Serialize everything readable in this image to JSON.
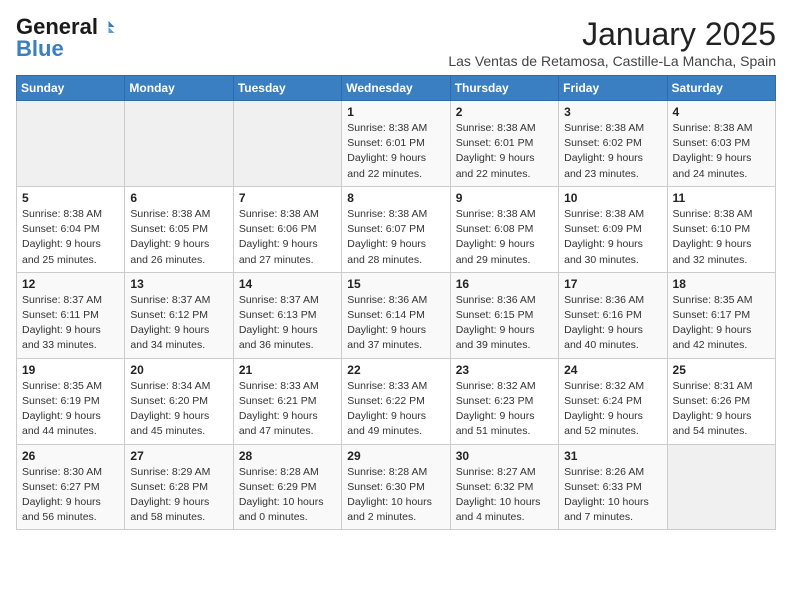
{
  "logo": {
    "general": "General",
    "blue": "Blue"
  },
  "title": "January 2025",
  "location": "Las Ventas de Retamosa, Castille-La Mancha, Spain",
  "weekdays": [
    "Sunday",
    "Monday",
    "Tuesday",
    "Wednesday",
    "Thursday",
    "Friday",
    "Saturday"
  ],
  "weeks": [
    [
      {
        "day": "",
        "info": ""
      },
      {
        "day": "",
        "info": ""
      },
      {
        "day": "",
        "info": ""
      },
      {
        "day": "1",
        "info": "Sunrise: 8:38 AM\nSunset: 6:01 PM\nDaylight: 9 hours\nand 22 minutes."
      },
      {
        "day": "2",
        "info": "Sunrise: 8:38 AM\nSunset: 6:01 PM\nDaylight: 9 hours\nand 22 minutes."
      },
      {
        "day": "3",
        "info": "Sunrise: 8:38 AM\nSunset: 6:02 PM\nDaylight: 9 hours\nand 23 minutes."
      },
      {
        "day": "4",
        "info": "Sunrise: 8:38 AM\nSunset: 6:03 PM\nDaylight: 9 hours\nand 24 minutes."
      }
    ],
    [
      {
        "day": "5",
        "info": "Sunrise: 8:38 AM\nSunset: 6:04 PM\nDaylight: 9 hours\nand 25 minutes."
      },
      {
        "day": "6",
        "info": "Sunrise: 8:38 AM\nSunset: 6:05 PM\nDaylight: 9 hours\nand 26 minutes."
      },
      {
        "day": "7",
        "info": "Sunrise: 8:38 AM\nSunset: 6:06 PM\nDaylight: 9 hours\nand 27 minutes."
      },
      {
        "day": "8",
        "info": "Sunrise: 8:38 AM\nSunset: 6:07 PM\nDaylight: 9 hours\nand 28 minutes."
      },
      {
        "day": "9",
        "info": "Sunrise: 8:38 AM\nSunset: 6:08 PM\nDaylight: 9 hours\nand 29 minutes."
      },
      {
        "day": "10",
        "info": "Sunrise: 8:38 AM\nSunset: 6:09 PM\nDaylight: 9 hours\nand 30 minutes."
      },
      {
        "day": "11",
        "info": "Sunrise: 8:38 AM\nSunset: 6:10 PM\nDaylight: 9 hours\nand 32 minutes."
      }
    ],
    [
      {
        "day": "12",
        "info": "Sunrise: 8:37 AM\nSunset: 6:11 PM\nDaylight: 9 hours\nand 33 minutes."
      },
      {
        "day": "13",
        "info": "Sunrise: 8:37 AM\nSunset: 6:12 PM\nDaylight: 9 hours\nand 34 minutes."
      },
      {
        "day": "14",
        "info": "Sunrise: 8:37 AM\nSunset: 6:13 PM\nDaylight: 9 hours\nand 36 minutes."
      },
      {
        "day": "15",
        "info": "Sunrise: 8:36 AM\nSunset: 6:14 PM\nDaylight: 9 hours\nand 37 minutes."
      },
      {
        "day": "16",
        "info": "Sunrise: 8:36 AM\nSunset: 6:15 PM\nDaylight: 9 hours\nand 39 minutes."
      },
      {
        "day": "17",
        "info": "Sunrise: 8:36 AM\nSunset: 6:16 PM\nDaylight: 9 hours\nand 40 minutes."
      },
      {
        "day": "18",
        "info": "Sunrise: 8:35 AM\nSunset: 6:17 PM\nDaylight: 9 hours\nand 42 minutes."
      }
    ],
    [
      {
        "day": "19",
        "info": "Sunrise: 8:35 AM\nSunset: 6:19 PM\nDaylight: 9 hours\nand 44 minutes."
      },
      {
        "day": "20",
        "info": "Sunrise: 8:34 AM\nSunset: 6:20 PM\nDaylight: 9 hours\nand 45 minutes."
      },
      {
        "day": "21",
        "info": "Sunrise: 8:33 AM\nSunset: 6:21 PM\nDaylight: 9 hours\nand 47 minutes."
      },
      {
        "day": "22",
        "info": "Sunrise: 8:33 AM\nSunset: 6:22 PM\nDaylight: 9 hours\nand 49 minutes."
      },
      {
        "day": "23",
        "info": "Sunrise: 8:32 AM\nSunset: 6:23 PM\nDaylight: 9 hours\nand 51 minutes."
      },
      {
        "day": "24",
        "info": "Sunrise: 8:32 AM\nSunset: 6:24 PM\nDaylight: 9 hours\nand 52 minutes."
      },
      {
        "day": "25",
        "info": "Sunrise: 8:31 AM\nSunset: 6:26 PM\nDaylight: 9 hours\nand 54 minutes."
      }
    ],
    [
      {
        "day": "26",
        "info": "Sunrise: 8:30 AM\nSunset: 6:27 PM\nDaylight: 9 hours\nand 56 minutes."
      },
      {
        "day": "27",
        "info": "Sunrise: 8:29 AM\nSunset: 6:28 PM\nDaylight: 9 hours\nand 58 minutes."
      },
      {
        "day": "28",
        "info": "Sunrise: 8:28 AM\nSunset: 6:29 PM\nDaylight: 10 hours\nand 0 minutes."
      },
      {
        "day": "29",
        "info": "Sunrise: 8:28 AM\nSunset: 6:30 PM\nDaylight: 10 hours\nand 2 minutes."
      },
      {
        "day": "30",
        "info": "Sunrise: 8:27 AM\nSunset: 6:32 PM\nDaylight: 10 hours\nand 4 minutes."
      },
      {
        "day": "31",
        "info": "Sunrise: 8:26 AM\nSunset: 6:33 PM\nDaylight: 10 hours\nand 7 minutes."
      },
      {
        "day": "",
        "info": ""
      }
    ]
  ]
}
